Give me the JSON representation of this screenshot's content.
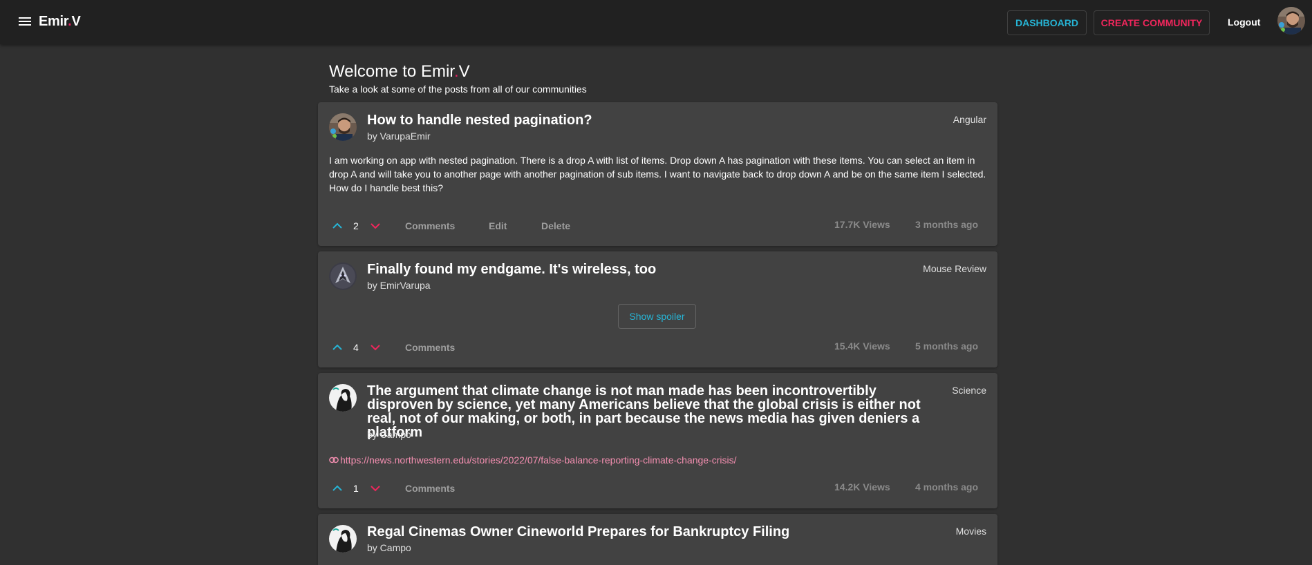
{
  "header": {
    "brand_main": "Emir",
    "brand_dot": ".",
    "brand_end": "V",
    "dashboard_label": "DASHBOARD",
    "create_label": "CREATE COMMUNITY",
    "logout_label": "Logout"
  },
  "welcome": {
    "title_main": "Welcome to Emir",
    "title_dot": ".",
    "title_end": "V",
    "subtitle": "Take a look at some of the posts from all of our communities"
  },
  "posts": [
    {
      "title": "How to handle nested pagination?",
      "author": "by VarupaEmir",
      "community": "Angular",
      "body": "I am working on app with nested pagination. There is a drop A with list of items. Drop down A has pagination with these items. You can select an item in drop A and will take you to another page with another pagination of sub items. I want to navigate back to drop down A and be on the same item I selected. How do I handle best this?",
      "votes": "2",
      "comments_label": "Comments",
      "edit_label": "Edit",
      "delete_label": "Delete",
      "views": "17.7K Views",
      "ago": "3 months ago"
    },
    {
      "title": "Finally found my endgame. It's wireless, too",
      "author": "by EmirVarupa",
      "community": "Mouse Review",
      "spoiler_label": "Show spoiler",
      "votes": "4",
      "comments_label": "Comments",
      "views": "15.4K Views",
      "ago": "5 months ago"
    },
    {
      "title": "The argument that climate change is not man made has been incontrovertibly disproven by science, yet many Americans believe that the global crisis is either not real, not of our making, or both, in part because the news media has given deniers a platform",
      "author": "by Campo",
      "community": "Science",
      "link": "https://news.northwestern.edu/stories/2022/07/false-balance-reporting-climate-change-crisis/",
      "votes": "1",
      "comments_label": "Comments",
      "views": "14.2K Views",
      "ago": "4 months ago"
    },
    {
      "title": "Regal Cinemas Owner Cineworld Prepares for Bankruptcy Filing",
      "author": "by Campo",
      "community": "Movies"
    }
  ],
  "colors": {
    "accent_cyan": "#26b5d6",
    "accent_pink": "#f0265c",
    "link_pink": "#f48fb1",
    "card_bg": "#424242",
    "page_bg": "#303030",
    "topbar_bg": "#212121"
  },
  "icons": {
    "menu": "menu-icon",
    "upvote": "chevron-up-icon",
    "downvote": "chevron-down-icon",
    "link": "link-icon"
  }
}
